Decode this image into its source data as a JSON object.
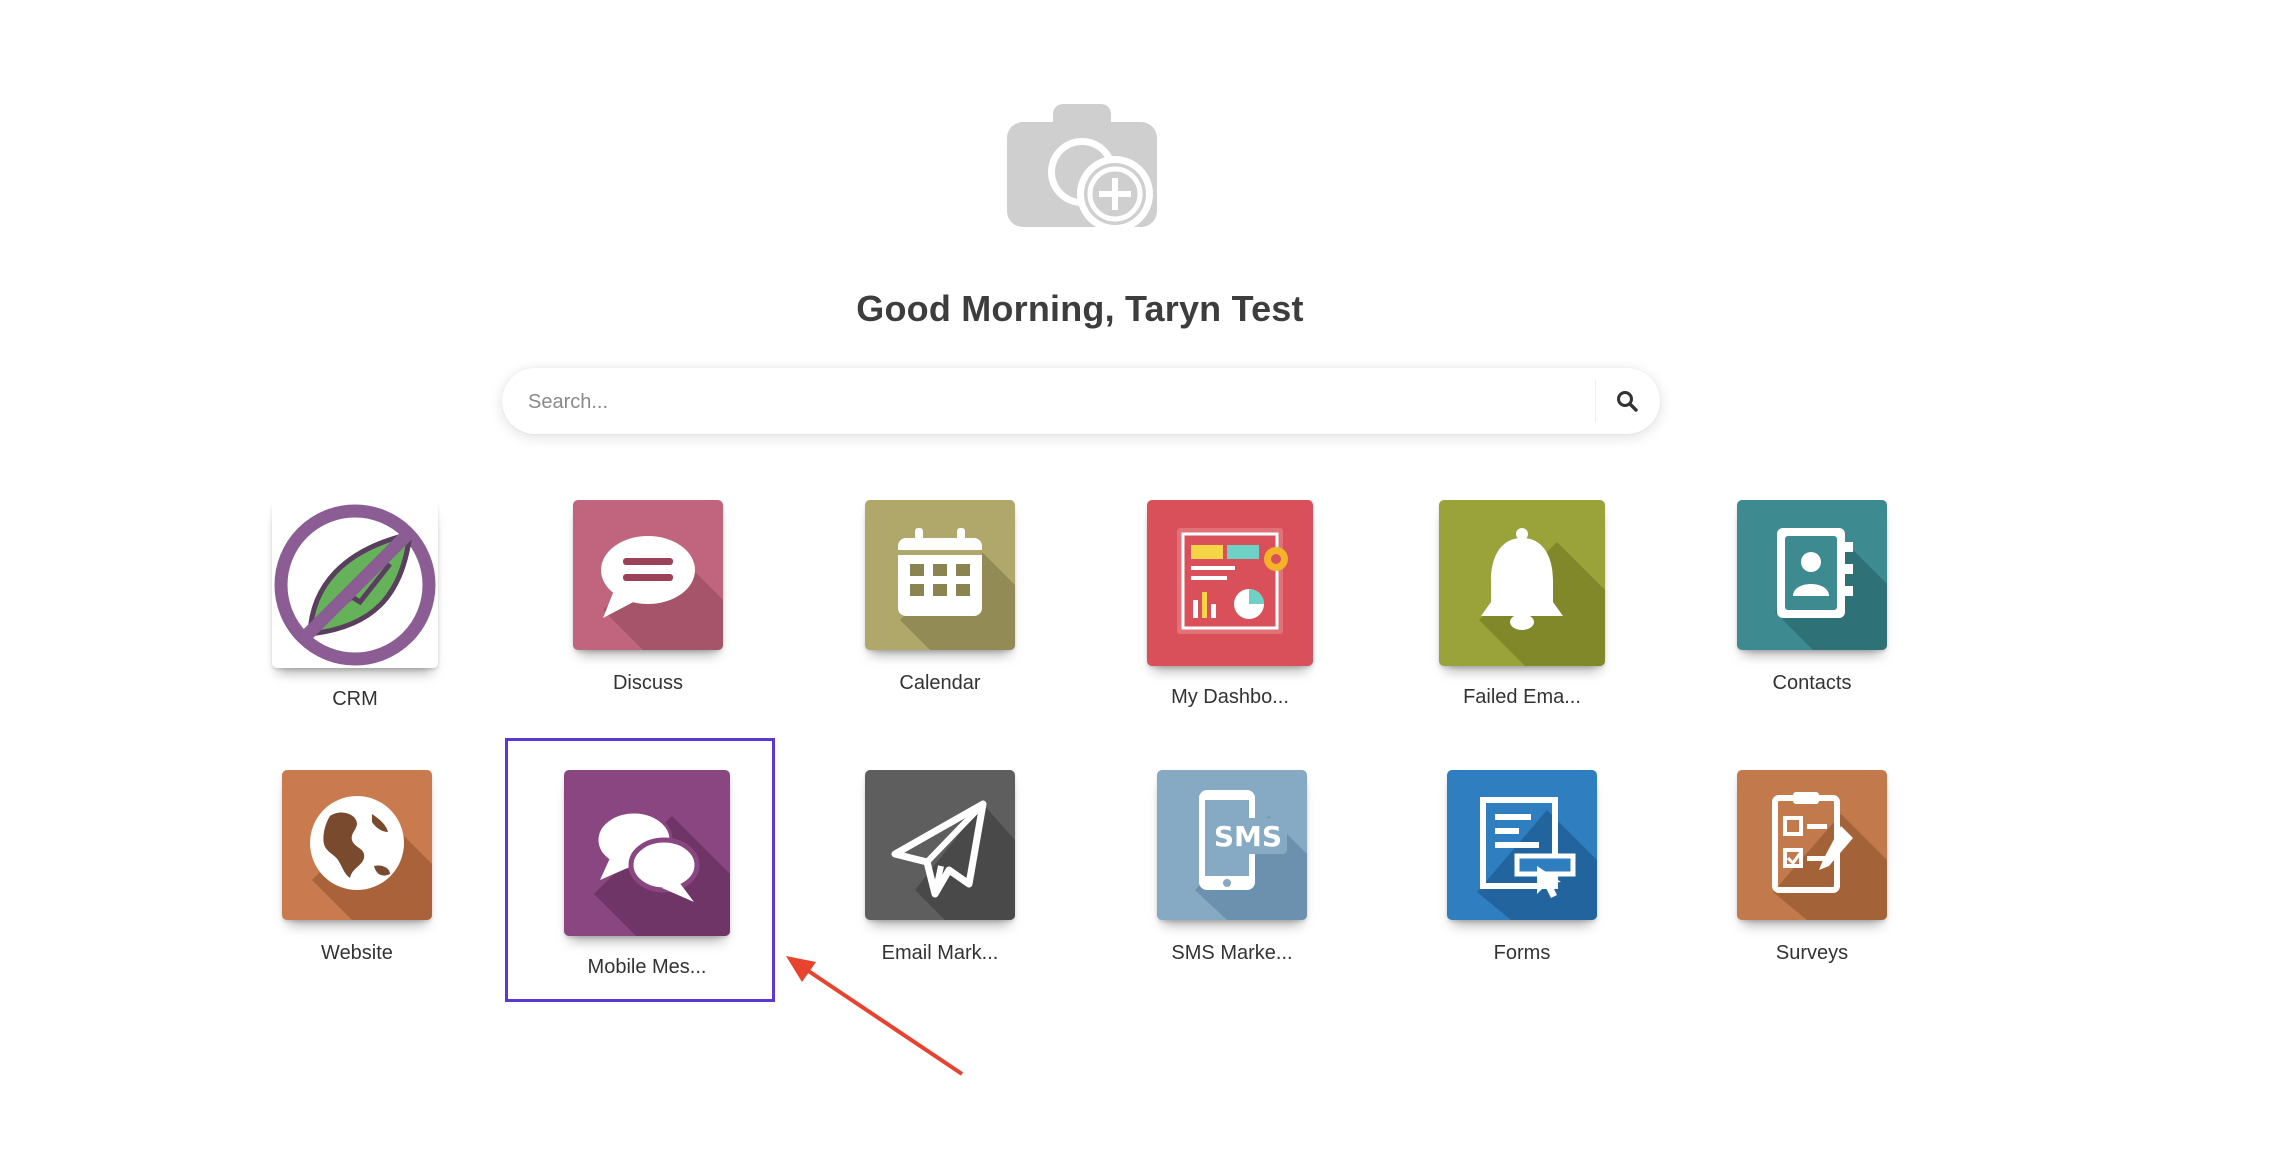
{
  "greeting": "Good Morning, Taryn Test",
  "search": {
    "placeholder": "Search..."
  },
  "apps": [
    {
      "label": "CRM",
      "icon": "crm-leaf-icon"
    },
    {
      "label": "Discuss",
      "icon": "chat-bubble-icon"
    },
    {
      "label": "Calendar",
      "icon": "calendar-icon"
    },
    {
      "label": "My Dashbo...",
      "icon": "dashboard-icon"
    },
    {
      "label": "Failed Ema...",
      "icon": "bell-icon"
    },
    {
      "label": "Contacts",
      "icon": "contact-book-icon"
    },
    {
      "label": "Website",
      "icon": "globe-icon"
    },
    {
      "label": "Mobile Mes...",
      "icon": "chat-bubbles-icon"
    },
    {
      "label": "Email Mark...",
      "icon": "paper-plane-icon"
    },
    {
      "label": "SMS Marke...",
      "icon": "sms-phone-icon"
    },
    {
      "label": "Forms",
      "icon": "form-icon"
    },
    {
      "label": "Surveys",
      "icon": "survey-clipboard-icon"
    }
  ],
  "colors": {
    "highlight": "#5b38d6",
    "arrow": "#e8432e",
    "crm": "#8b5d94",
    "discuss": "#c0657d",
    "calendar": "#b0a76a",
    "dashboard": "#d9505a",
    "failed_email": "#9aa23a",
    "contacts": "#3d8a91",
    "website": "#c97a4e",
    "mobile_messages": "#8a4680",
    "email_marketing": "#5e5e5e",
    "sms_marketing": "#86a9c4",
    "forms": "#2f7fc0",
    "surveys": "#c27a4c"
  }
}
